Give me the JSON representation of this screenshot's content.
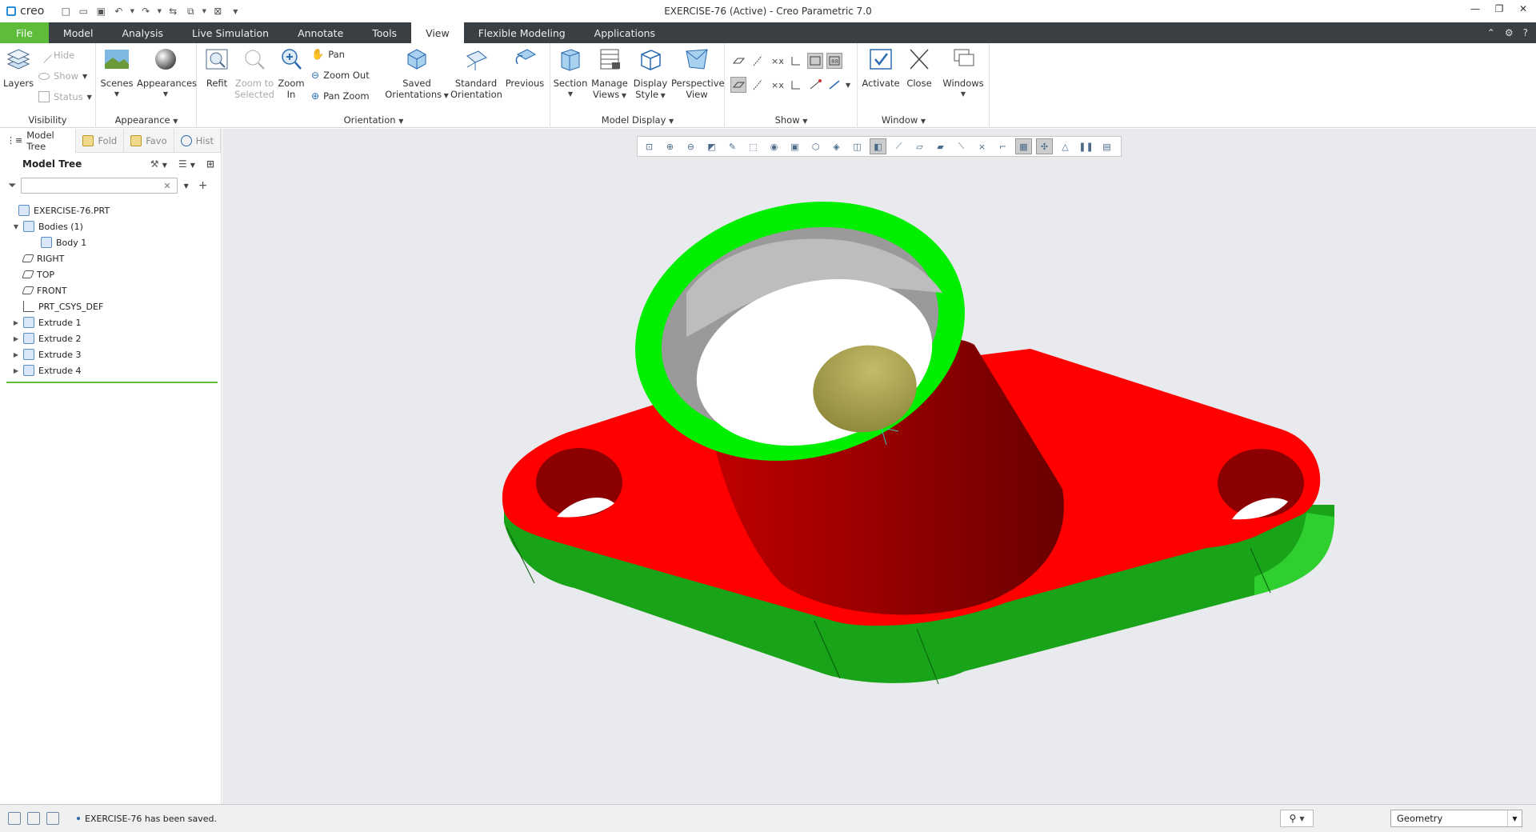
{
  "app": {
    "brand": "creo",
    "window_title": "EXERCISE-76 (Active) - Creo Parametric 7.0"
  },
  "tabs": [
    "File",
    "Model",
    "Analysis",
    "Live Simulation",
    "Annotate",
    "Tools",
    "View",
    "Flexible Modeling",
    "Applications"
  ],
  "active_tab": "View",
  "ribbon": {
    "visibility": {
      "label": "Visibility",
      "layers": "Layers",
      "hide": "Hide",
      "show": "Show",
      "status": "Status"
    },
    "appearance": {
      "label": "Appearance",
      "scenes": "Scenes",
      "appearances": "Appearances"
    },
    "orientation": {
      "label": "Orientation",
      "refit": "Refit",
      "zoom_to_selected_1": "Zoom to",
      "zoom_to_selected_2": "Selected",
      "zoom_in_1": "Zoom",
      "zoom_in_2": "In",
      "pan": "Pan",
      "zoom_out": "Zoom Out",
      "pan_zoom": "Pan Zoom",
      "saved_1": "Saved",
      "saved_2": "Orientations",
      "standard_1": "Standard",
      "standard_2": "Orientation",
      "previous": "Previous"
    },
    "model_display": {
      "label": "Model Display",
      "section": "Section",
      "manage_1": "Manage",
      "manage_2": "Views",
      "display_1": "Display",
      "display_2": "Style",
      "perspective_1": "Perspective",
      "perspective_2": "View"
    },
    "show": {
      "label": "Show"
    },
    "window": {
      "label": "Window",
      "activate": "Activate",
      "close": "Close"
    },
    "windows": {
      "label": "Windows"
    }
  },
  "left_panel": {
    "tabs": [
      "Model Tree",
      "Fold",
      "Favo",
      "Hist"
    ],
    "header": "Model Tree",
    "filter_placeholder": "",
    "tree": [
      {
        "label": "EXERCISE-76.PRT",
        "level": 0,
        "expander": "",
        "icon": "part-icon"
      },
      {
        "label": "Bodies (1)",
        "level": 1,
        "expander": "▼",
        "icon": "bodies-icon"
      },
      {
        "label": "Body 1",
        "level": 2,
        "expander": "",
        "icon": "body-icon"
      },
      {
        "label": "RIGHT",
        "level": 1,
        "expander": "",
        "icon": "datum-plane-icon"
      },
      {
        "label": "TOP",
        "level": 1,
        "expander": "",
        "icon": "datum-plane-icon"
      },
      {
        "label": "FRONT",
        "level": 1,
        "expander": "",
        "icon": "datum-plane-icon"
      },
      {
        "label": "PRT_CSYS_DEF",
        "level": 1,
        "expander": "",
        "icon": "csys-icon"
      },
      {
        "label": "Extrude 1",
        "level": 1,
        "expander": "▶",
        "icon": "extrude-icon"
      },
      {
        "label": "Extrude 2",
        "level": 1,
        "expander": "▶",
        "icon": "extrude-icon"
      },
      {
        "label": "Extrude 3",
        "level": 1,
        "expander": "▶",
        "icon": "extrude-icon"
      },
      {
        "label": "Extrude 4",
        "level": 1,
        "expander": "▶",
        "icon": "extrude-icon"
      }
    ]
  },
  "status": {
    "message": "EXERCISE-76 has been saved.",
    "selection_filter": "Geometry"
  },
  "colors": {
    "accent_green": "#5dbd3a",
    "tabbar": "#3a3f44",
    "model_red": "#ff0000",
    "model_green": "#00ee00",
    "model_side_green": "#19a319"
  }
}
